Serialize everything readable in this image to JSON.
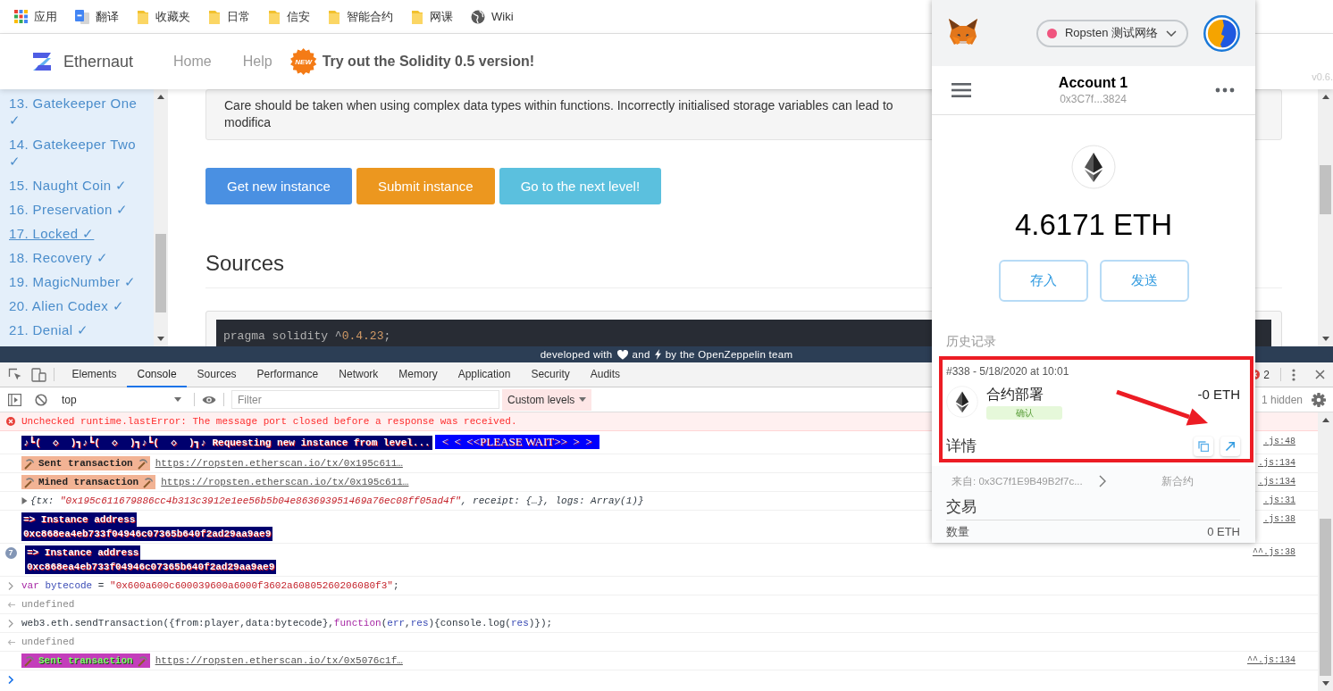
{
  "bookmarks": [
    {
      "kind": "apps",
      "label": "应用"
    },
    {
      "kind": "pages",
      "label": "翻译"
    },
    {
      "kind": "folder",
      "label": "收藏夹"
    },
    {
      "kind": "folder",
      "label": "日常"
    },
    {
      "kind": "folder",
      "label": "信安"
    },
    {
      "kind": "folder",
      "label": "智能合约"
    },
    {
      "kind": "folder",
      "label": "网课"
    },
    {
      "kind": "globe",
      "label": "Wiki"
    }
  ],
  "site_header": {
    "brand": "Ethernaut",
    "nav": [
      "Home",
      "Help"
    ],
    "badge": "NEW",
    "promo": "Try out the Solidity 0.5 version!",
    "version": "v0.6."
  },
  "sidebar": {
    "items": [
      {
        "label": "13. Gatekeeper One ✓",
        "selected": false
      },
      {
        "label": "14. Gatekeeper Two ✓",
        "selected": false
      },
      {
        "label": "15. Naught Coin ✓",
        "selected": false
      },
      {
        "label": "16. Preservation ✓",
        "selected": false
      },
      {
        "label": "17. Locked ✓",
        "selected": true
      },
      {
        "label": "18. Recovery ✓",
        "selected": false
      },
      {
        "label": "19. MagicNumber ✓",
        "selected": false
      },
      {
        "label": "20. Alien Codex ✓",
        "selected": false
      },
      {
        "label": "21. Denial ✓",
        "selected": false
      }
    ]
  },
  "level": {
    "note": "Care should be taken when using complex data types within functions. Incorrectly initialised storage variables can lead to modifica",
    "buttons": [
      {
        "label": "Get new instance",
        "kind": "primary"
      },
      {
        "label": "Submit instance",
        "kind": "warning"
      },
      {
        "label": "Go to the next level!",
        "kind": "info"
      }
    ],
    "sources_heading": "Sources",
    "code": [
      {
        "text": "pragma solidity ^",
        "kind": "plain"
      },
      {
        "text": "0.4.23",
        "kind": "number"
      },
      {
        "text": ";",
        "kind": "plain"
      }
    ]
  },
  "footer": {
    "before": "developed with",
    "middle": "and",
    "after": "by the OpenZeppelin team"
  },
  "devtools": {
    "tabs": [
      {
        "label": "Elements",
        "selected": false
      },
      {
        "label": "Console",
        "selected": true
      },
      {
        "label": "Sources",
        "selected": false
      },
      {
        "label": "Performance",
        "selected": false
      },
      {
        "label": "Network",
        "selected": false
      },
      {
        "label": "Memory",
        "selected": false
      },
      {
        "label": "Application",
        "selected": false
      },
      {
        "label": "Security",
        "selected": false
      },
      {
        "label": "Audits",
        "selected": false
      }
    ],
    "error_count": "2",
    "context": "top",
    "filter": {
      "placeholder": "Filter"
    },
    "levels": "Custom levels",
    "hidden": "1 hidden",
    "console": [
      {
        "kind": "error",
        "text": "Unchecked runtime.lastError: The message port closed before a response was received."
      },
      {
        "kind": "banner",
        "messages": [
          "♪┗(  ◇  )┓♪┗(  ◇  )┓♪┗(  ◇  )┓♪ Requesting new instance from level...",
          "<  <  <<PLEASE WAIT>>  >  >"
        ],
        "source": ".js:48"
      },
      {
        "kind": "tx",
        "label": "Sent transaction",
        "link": "https://ropsten.etherscan.io/tx/0x195c611…",
        "source": ".js:134"
      },
      {
        "kind": "tx",
        "label": "Mined transaction",
        "link": "https://ropsten.etherscan.io/tx/0x195c611…",
        "source": ".js:134"
      },
      {
        "kind": "object",
        "expanded": false,
        "tokens": [
          {
            "text": "{tx: ",
            "kind": "plain"
          },
          {
            "text": "\"0x195c611679886cc4b313c3912e1ee56b5b04e863693951469a76ec08ff05ad4f\"",
            "kind": "string"
          },
          {
            "text": ", receipt: {…}, logs: Array(1)}",
            "kind": "plain"
          }
        ],
        "source": ".js:31"
      },
      {
        "kind": "block",
        "lines": [
          "=> Instance address",
          "0xc868ea4eb733f04946c07365b640f2ad29aa9ae9"
        ],
        "source": ".js:38"
      },
      {
        "kind": "block",
        "repeat": "7",
        "lines": [
          "=> Instance address",
          "0xc868ea4eb733f04946c07365b640f2ad29aa9ae9"
        ],
        "source": "^^.js:38"
      },
      {
        "kind": "input",
        "tokens": [
          {
            "text": "var ",
            "kind": "keyword"
          },
          {
            "text": "bytecode",
            "kind": "variable"
          },
          {
            "text": " = ",
            "kind": "plain"
          },
          {
            "text": "\"0x600a600c600039600a6000f3602a60805260206080f3\"",
            "kind": "string"
          },
          {
            "text": ";",
            "kind": "plain"
          }
        ]
      },
      {
        "kind": "result",
        "text": "undefined"
      },
      {
        "kind": "input",
        "tokens": [
          {
            "text": "web3.eth.sendTransaction({from:player,data:bytecode},",
            "kind": "plain"
          },
          {
            "text": "function",
            "kind": "keyword"
          },
          {
            "text": "(",
            "kind": "plain"
          },
          {
            "text": "err",
            "kind": "variable"
          },
          {
            "text": ",",
            "kind": "plain"
          },
          {
            "text": "res",
            "kind": "variable"
          },
          {
            "text": "){console.log(",
            "kind": "plain"
          },
          {
            "text": "res",
            "kind": "variable"
          },
          {
            "text": ")});",
            "kind": "plain"
          }
        ]
      },
      {
        "kind": "result",
        "text": "undefined"
      },
      {
        "kind": "txlog",
        "label": "Sent transaction",
        "link": "https://ropsten.etherscan.io/tx/0x5076c1f…",
        "source": "^^.js:134"
      },
      {
        "kind": "prompt"
      }
    ]
  },
  "wallet": {
    "network": "Ropsten 测试网络",
    "account": {
      "name": "Account 1",
      "address": "0x3C7f...3824"
    },
    "balance": "4.6171 ETH",
    "actions": [
      "存入",
      "发送"
    ],
    "history_heading": "历史记录",
    "transaction": {
      "meta": "#338 - 5/18/2020 at 10:01",
      "title": "合约部署",
      "status": "确认",
      "amount": "-0 ETH",
      "details_label": "详情",
      "from": "来自: 0x3C7f1E9B49B2f7c...",
      "to": "新合约",
      "section": "交易",
      "rows": [
        {
          "label": "数量",
          "value": "0 ETH"
        }
      ]
    }
  }
}
